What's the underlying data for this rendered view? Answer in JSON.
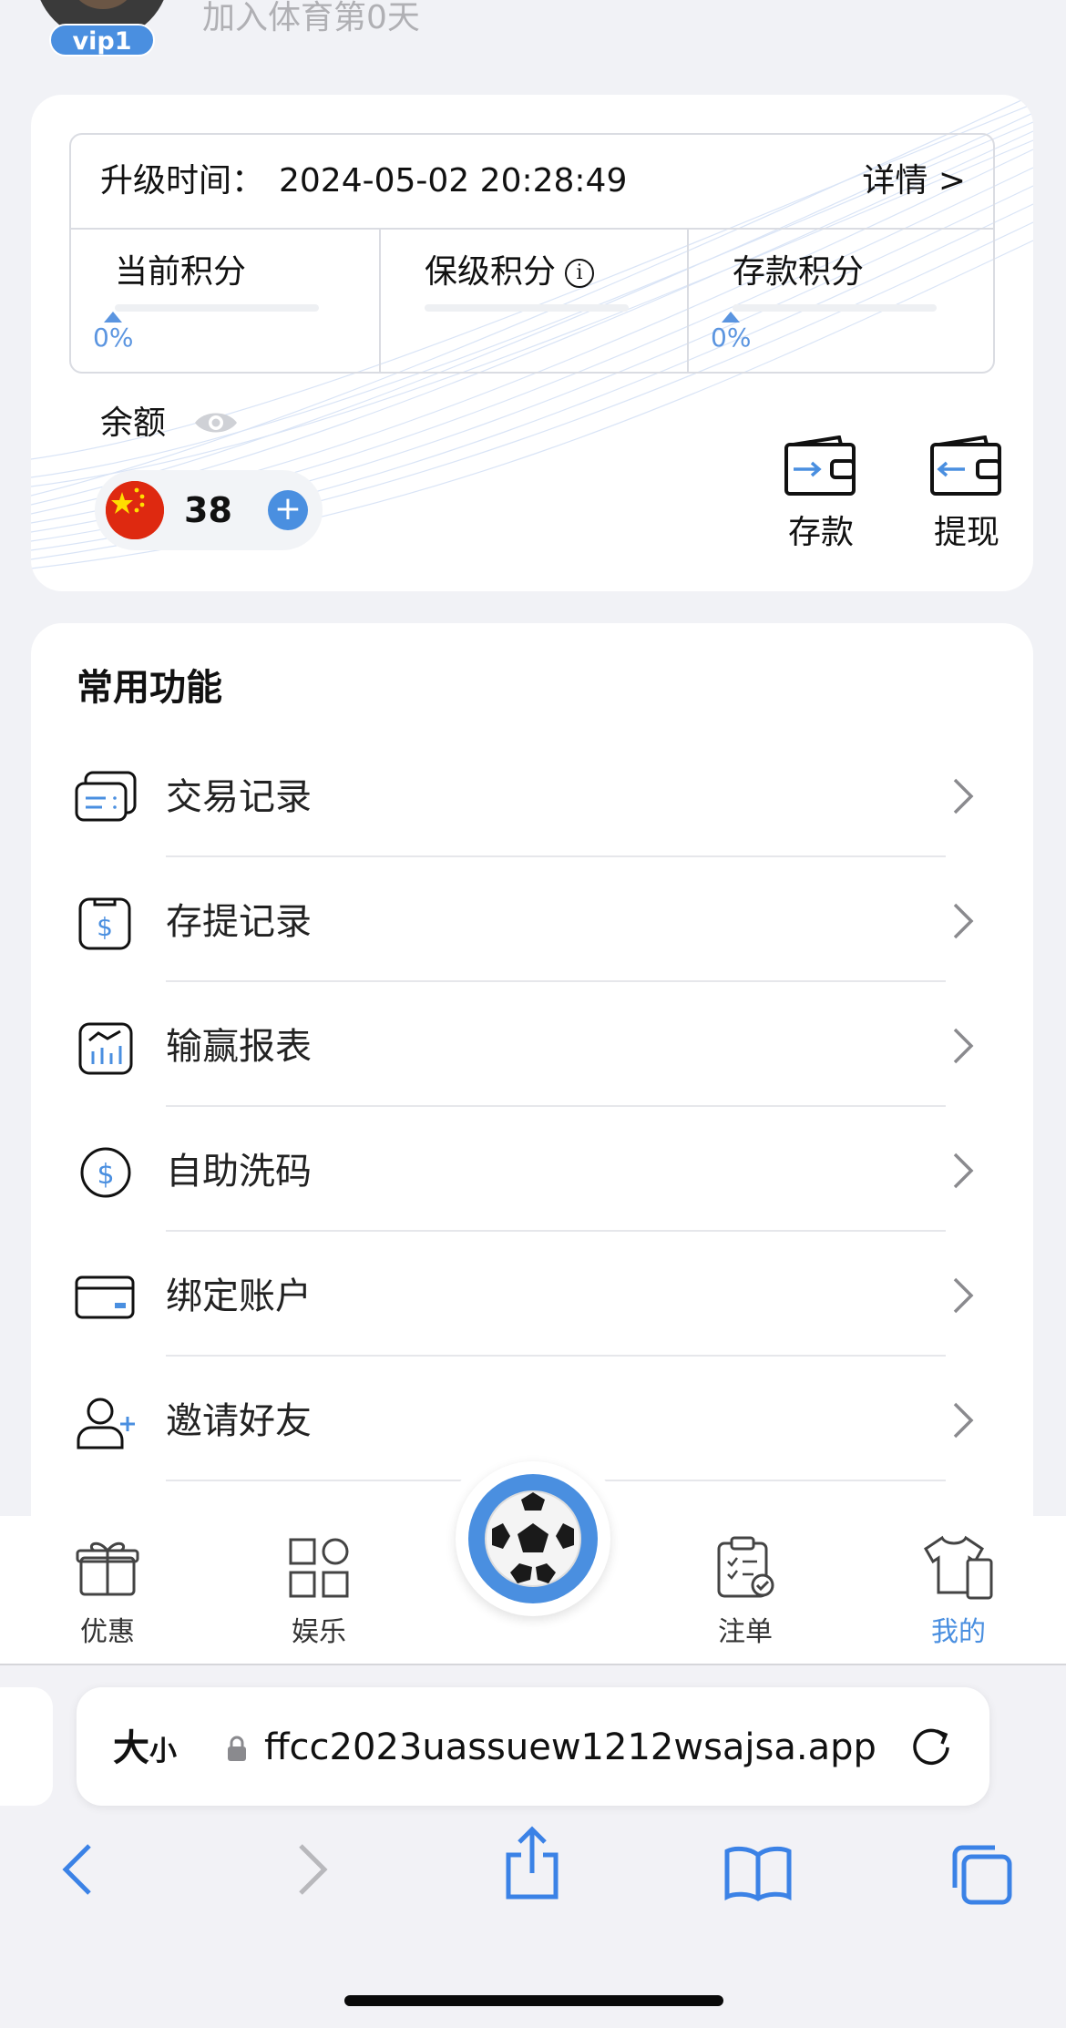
{
  "header": {
    "vip_label": "vip1",
    "join_text": "加入体育第0天"
  },
  "level_card": {
    "upgrade_label": "升级时间：",
    "upgrade_time": "2024-05-02 20:28:49",
    "detail_link": "详情 >",
    "scores": [
      {
        "title": "当前积分",
        "progress": 0,
        "percent_text": "0%"
      },
      {
        "title": "保级积分",
        "info_icon": "info-icon"
      },
      {
        "title": "存款积分",
        "progress": 0,
        "percent_text": "0%"
      }
    ],
    "balance_label": "余额",
    "balance_value": "38",
    "currency_flag": "china-flag-icon",
    "deposit_label": "存款",
    "withdraw_label": "提现"
  },
  "functions": {
    "title": "常用功能",
    "items": [
      {
        "label": "交易记录",
        "icon": "transaction-record-icon"
      },
      {
        "label": "存提记录",
        "icon": "deposit-withdraw-record-icon"
      },
      {
        "label": "输赢报表",
        "icon": "win-loss-report-icon"
      },
      {
        "label": "自助洗码",
        "icon": "self-rebate-icon"
      },
      {
        "label": "绑定账户",
        "icon": "bind-account-icon"
      },
      {
        "label": "邀请好友",
        "icon": "invite-friend-icon"
      }
    ]
  },
  "tabbar": {
    "tabs": [
      {
        "label": "优惠",
        "icon": "gift-icon"
      },
      {
        "label": "娱乐",
        "icon": "grid-icon"
      },
      {
        "label": "注单",
        "icon": "clipboard-icon"
      },
      {
        "label": "我的",
        "icon": "shirt-icon",
        "active": true
      }
    ],
    "center_icon": "soccer-ball-icon"
  },
  "browser": {
    "text_size_label_big": "大",
    "text_size_label_small": "小",
    "url": "ffcc2023uassuew1212wsajsa.app"
  },
  "colors": {
    "accent": "#4a8fe0",
    "background": "#f1f2f6"
  }
}
